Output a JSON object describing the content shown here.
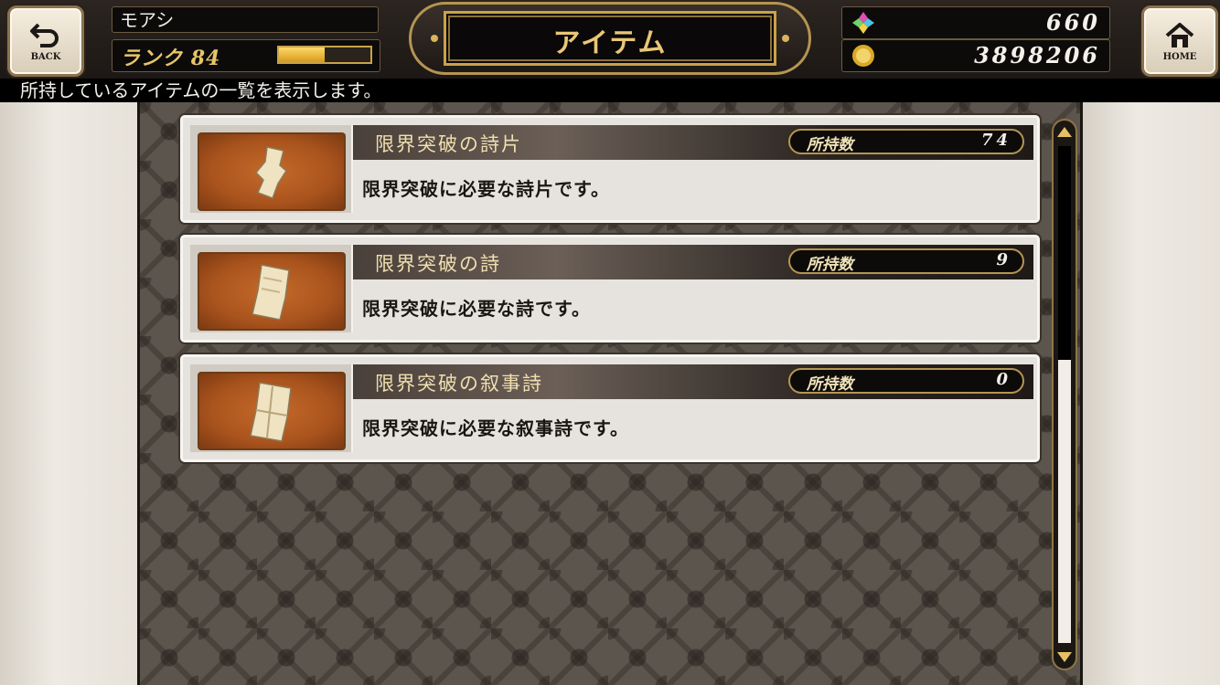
{
  "header": {
    "back_label": "BACK",
    "home_label": "HOME",
    "player_name": "モアシ",
    "rank_label": "ランク",
    "rank_value": "84",
    "rank_progress": 0.5,
    "title": "アイテム",
    "gems": "660",
    "coins": "3898206",
    "icons": [
      "back-arrow-icon",
      "home-icon",
      "rainbow-gem-icon",
      "gold-coin-icon"
    ]
  },
  "info": "所持しているアイテムの一覧を表示します。",
  "items": [
    {
      "name": "限界突破の詩片",
      "owned_label": "所持数",
      "owned": "74",
      "description": "限界突破に必要な詩片です。"
    },
    {
      "name": "限界突破の詩",
      "owned_label": "所持数",
      "owned": "9",
      "description": "限界突破に必要な詩です。"
    },
    {
      "name": "限界突破の叙事詩",
      "owned_label": "所持数",
      "owned": "0",
      "description": "限界突破に必要な叙事詩です。"
    }
  ],
  "scroll_position": 0.0,
  "colors": {
    "gold": "#c9a24a",
    "thumb_orange": "#b85f24",
    "bar_dark": "#0d0b0a"
  }
}
